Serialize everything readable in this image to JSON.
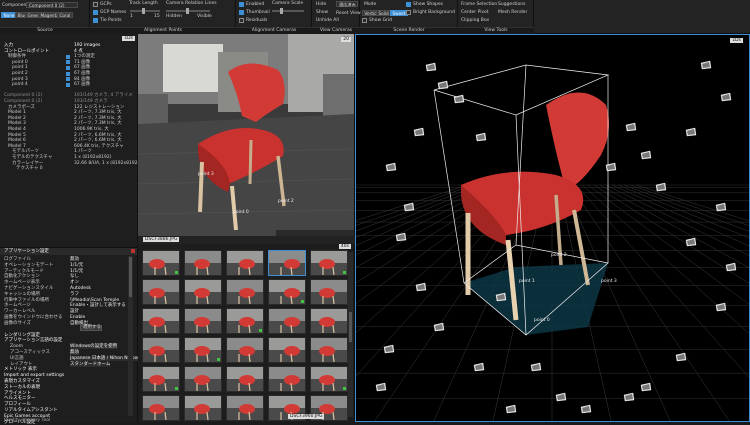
{
  "ribbon": {
    "component_label": "Component",
    "component_value": "Component 0 (2)",
    "color_buttons": [
      "None",
      "Blue",
      "Green",
      "Magenta",
      "Coral"
    ],
    "src_label": "Source",
    "align_checks": [
      {
        "label": "GCPs",
        "on": false
      },
      {
        "label": "GCP Names",
        "on": true
      },
      {
        "label": "Tie Points",
        "on": true
      }
    ],
    "track_length": {
      "label": "Track Length",
      "min": "1",
      "max": "15"
    },
    "camera_relation": {
      "label": "Camera Relation Lines",
      "min": "Hidden",
      "max": "Visible"
    },
    "align_label": "Alignment Points",
    "cam_checks": [
      {
        "label": "Enabled",
        "on": true
      },
      {
        "label": "Thumbnail",
        "on": true
      },
      {
        "label": "Residuals",
        "on": false
      }
    ],
    "camera_scale": {
      "label": "Camera Scale"
    },
    "align_cams_label": "Alignment Cameras",
    "hide_col": [
      "Hide",
      "Show",
      "Unhide All"
    ],
    "mode_jp": "適応済み",
    "reset_view": "Reset View",
    "view_cams_label": "View Cameras",
    "mode_label": "Mode",
    "mode_buttons": [
      "Vertices",
      "Solid",
      "Sweet"
    ],
    "scene_checks": [
      {
        "label": "Show Grid",
        "on": false
      },
      {
        "label": "Show Shapes",
        "on": true
      },
      {
        "label": "Bright Background",
        "on": false
      }
    ],
    "scene_render_label": "Scene Render",
    "tools": [
      "Frame Selection",
      "Suggestions",
      "Center Pivot",
      "Mesh Render",
      "Clipping Box"
    ],
    "view_tools_label": "View Tools"
  },
  "tree": {
    "header": "1Ds",
    "rows": [
      {
        "t": "入力",
        "v": "192 images",
        "i": 0,
        "c": "#fff"
      },
      {
        "t": "コントロールポイント",
        "v": "4 点",
        "i": 0,
        "c": "#fff"
      },
      {
        "t": "制御条件",
        "v": "1つの測定",
        "i": 1,
        "c": "#ccc"
      },
      {
        "t": "point 0",
        "v": "71 画像",
        "i": 2,
        "c": "#ccc"
      },
      {
        "t": "point 1",
        "v": "67 画像",
        "i": 2,
        "c": "#ccc"
      },
      {
        "t": "point 2",
        "v": "67 画像",
        "i": 2,
        "c": "#ccc"
      },
      {
        "t": "point 3",
        "v": "84 画像",
        "i": 2,
        "c": "#ccc"
      },
      {
        "t": "point 4",
        "v": "67 画像",
        "i": 2,
        "c": "#ccc"
      },
      {
        "t": "",
        "v": "",
        "i": 0,
        "c": "#ccc"
      },
      {
        "t": "Component 0 (2)",
        "v": "103/149 カメラ, 4 アライメ",
        "i": 0,
        "c": "#8f8f8f"
      },
      {
        "t": "Component 0 (2)",
        "v": "103/149 カメラ",
        "i": 0,
        "c": "#8f8f8f"
      },
      {
        "t": "カメラポーズ",
        "v": "122 レジストレーション",
        "i": 1,
        "c": "#ccc"
      },
      {
        "t": "Model 1",
        "v": "2 パーツ, 7.3M tris, 大",
        "i": 1,
        "c": "#ccc"
      },
      {
        "t": "Model 2",
        "v": "2 パーツ, 7.3M tris, 大",
        "i": 1,
        "c": "#ccc"
      },
      {
        "t": "Model 3",
        "v": "2 パーツ, 7.3M tris, 大",
        "i": 1,
        "c": "#ccc"
      },
      {
        "t": "Model 4",
        "v": "1006.9K tris, 大",
        "i": 1,
        "c": "#ccc"
      },
      {
        "t": "Model 5",
        "v": "2 パーツ, 6.6M tris, 大",
        "i": 1,
        "c": "#ccc"
      },
      {
        "t": "Model 6",
        "v": "2 パーツ, 6.6M tris, 大",
        "i": 1,
        "c": "#ccc"
      },
      {
        "t": "Model 7",
        "v": "606.4K tris, テクスチャ",
        "i": 1,
        "c": "#ccc"
      },
      {
        "t": "モデルパーツ",
        "v": "1 パーツ",
        "i": 2,
        "c": "#ccc"
      },
      {
        "t": "モデルのテクスチャ",
        "v": "1 x (8192x8192)",
        "i": 2,
        "c": "#ccc"
      },
      {
        "t": "カラーレイヤー",
        "v": "32.66 8/UA, 1 x (8192x8192)",
        "i": 2,
        "c": "#ccc"
      },
      {
        "t": "テクスチャ 0",
        "v": "",
        "i": 3,
        "c": "#ccc"
      }
    ]
  },
  "photo": {
    "tag": "20",
    "labels": [
      "point 3",
      "point 0",
      "point 2"
    ],
    "bar": "DSCF3886.JPG"
  },
  "gallery": {
    "header": "40s",
    "footer": "DSCF3960.JPG",
    "more": "..."
  },
  "settings": {
    "title": "アプリケーション設定",
    "rows": [
      [
        "ログファイル",
        "無効"
      ],
      [
        "オペレーションモデート",
        "1/1/元"
      ],
      [
        "アーティクルモード",
        "1/1/元"
      ],
      [
        "自動化アクション",
        "なし"
      ],
      [
        "ホームページ表示",
        "オン"
      ],
      [
        "ナビゲーションスタイル",
        "Autodesk"
      ],
      [
        "キャッシュの場所",
        "ラフ"
      ],
      [
        "行車中ファイルの場所",
        "\\\\Meadia\\Scan Temple"
      ],
      [
        "ホームページ",
        "Enable・設計して表示する"
      ],
      [
        "ワーカーレベル",
        "設計"
      ],
      [
        "画像をウインドウに合わせる",
        "Enable"
      ],
      [
        "画像のサイズ",
        "自動検出"
      ]
    ],
    "section1": "レンダリング設定",
    "section2": "アプリケーション言語の設定",
    "lang_rows": [
      [
        "Zoom",
        "Windowsの設定を使用"
      ],
      [
        "アコースティックス",
        "無効"
      ],
      [
        "UI言語",
        "Japanese 日本語 / Nihon Nippon"
      ],
      [
        "レイアウト",
        "スタンダードホーム"
      ]
    ],
    "subsections": [
      "メトリック 表示",
      "Import and export settings",
      "表現カスタマイズ",
      "ストーカルの表現",
      "アライメント",
      "ヘルスモニター",
      "プロフィール",
      "リアルタイムアシスタント",
      "Epic Games account",
      "グローバル設定"
    ],
    "button": "適用する",
    "bottom_tab": "Quality imagery Tool"
  },
  "scene": {
    "tag": "1Ds",
    "point_labels": [
      "point 1",
      "point 3",
      "point 2",
      "point 0"
    ]
  }
}
